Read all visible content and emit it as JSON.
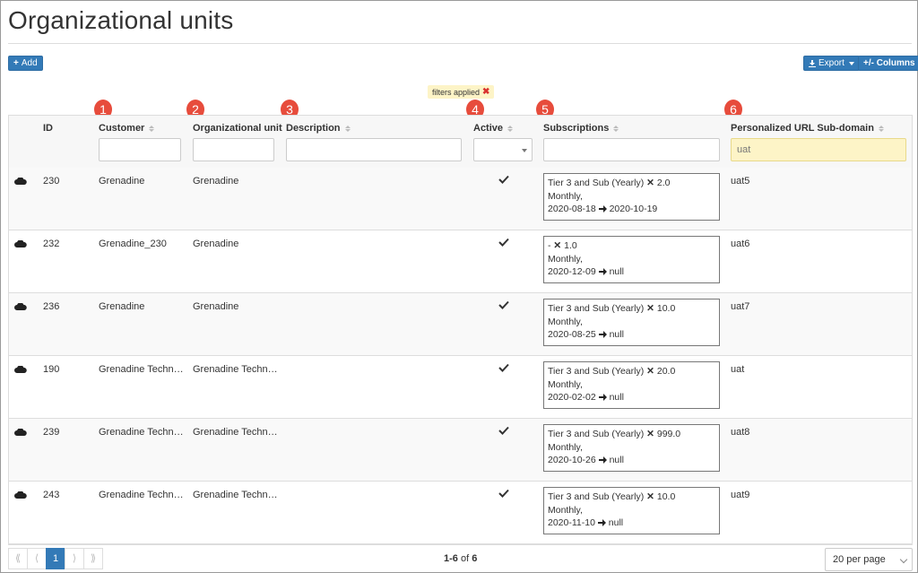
{
  "page_title": "Organizational units",
  "toolbar": {
    "add_label": "Add",
    "export_label": "Export",
    "columns_label": "+/- Columns"
  },
  "filters_applied": "filters applied",
  "annotations": [
    "1",
    "2",
    "3",
    "4",
    "5",
    "6"
  ],
  "columns": {
    "id": "ID",
    "customer": "Customer",
    "org_unit": "Organizational unit",
    "description": "Description",
    "active": "Active",
    "subscriptions": "Subscriptions",
    "subdomain": "Personalized URL Sub-domain"
  },
  "column_filters": {
    "subdomain_value": "uat"
  },
  "rows": [
    {
      "id": "230",
      "customer": "Grenadine",
      "org_unit": "Grenadine",
      "sub_line1_plan": "Tier 3 and Sub (Yearly)",
      "sub_line1_qty": "2.0",
      "sub_line2": "Monthly,",
      "sub_start": "2020-08-18",
      "sub_end": "2020-10-19",
      "subdomain": "uat5"
    },
    {
      "id": "232",
      "customer": "Grenadine_230",
      "org_unit": "Grenadine",
      "sub_line1_plan": "-",
      "sub_line1_qty": "1.0",
      "sub_line2": "Monthly,",
      "sub_start": "2020-12-09",
      "sub_end": "null",
      "subdomain": "uat6"
    },
    {
      "id": "236",
      "customer": "Grenadine",
      "org_unit": "Grenadine",
      "sub_line1_plan": "Tier 3 and Sub (Yearly)",
      "sub_line1_qty": "10.0",
      "sub_line2": "Monthly,",
      "sub_start": "2020-08-25",
      "sub_end": "null",
      "subdomain": "uat7"
    },
    {
      "id": "190",
      "customer": "Grenadine Techn…",
      "org_unit": "Grenadine Techn…",
      "sub_line1_plan": "Tier 3 and Sub (Yearly)",
      "sub_line1_qty": "20.0",
      "sub_line2": "Monthly,",
      "sub_start": "2020-02-02",
      "sub_end": "null",
      "subdomain": "uat"
    },
    {
      "id": "239",
      "customer": "Grenadine Techn…",
      "org_unit": "Grenadine Techn…",
      "sub_line1_plan": "Tier 3 and Sub (Yearly)",
      "sub_line1_qty": "999.0",
      "sub_line2": "Monthly,",
      "sub_start": "2020-10-26",
      "sub_end": "null",
      "subdomain": "uat8"
    },
    {
      "id": "243",
      "customer": "Grenadine Techn…",
      "org_unit": "Grenadine Techn…",
      "sub_line1_plan": "Tier 3 and Sub (Yearly)",
      "sub_line1_qty": "10.0",
      "sub_line2": "Monthly,",
      "sub_start": "2020-11-10",
      "sub_end": "null",
      "subdomain": "uat9"
    }
  ],
  "pagination": {
    "first": "⟪",
    "prev": "⟨",
    "current": "1",
    "next": "⟩",
    "last": "⟫",
    "range": "1-6",
    "of": "of",
    "total": "6",
    "per_page": "20 per page"
  },
  "colors": {
    "primary": "#337ab7",
    "highlight": "#fdf4c7",
    "badge": "#e74c3c",
    "remove": "#d9322e"
  },
  "icons": {
    "row": "cloud-icon",
    "active": "check-icon",
    "arrow": "arrow-right-icon",
    "export": "download-icon"
  }
}
